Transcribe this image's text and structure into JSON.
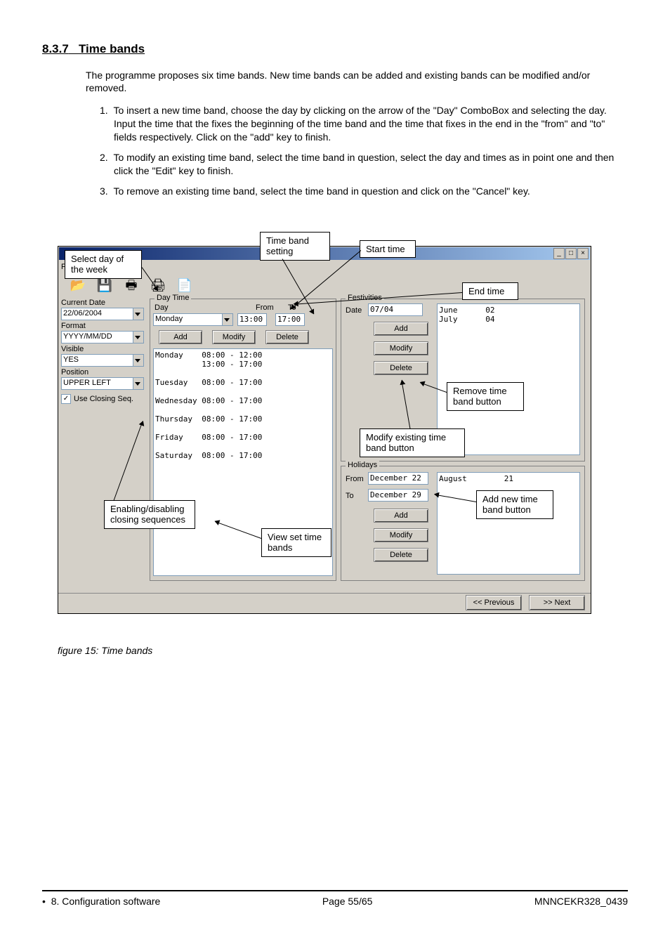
{
  "heading": {
    "number": "8.3.7",
    "title": "Time bands"
  },
  "intro": "The programme proposes six time bands. New time bands can be added and existing bands can be modified and/or removed.",
  "steps": [
    "To insert a new time band, choose the day by clicking on the arrow of the \"Day\" ComboBox and selecting the day. Input the time that the fixes the beginning of the time band and the time that fixes in the end in the  \"from\" and \"to\" fields respectively. Click on the \"add\" key to finish.",
    "To modify an existing time band, select the time band in question, select the day and times as in point one and then click the \"Edit\" key to finish.",
    "To remove an existing time band, select the time band in question and click on the \"Cancel\" key."
  ],
  "figure_caption": "figure 15: Time bands",
  "callouts": {
    "select_day": "Select  day of the week",
    "time_band_setting": "Time band setting",
    "start_time": "Start time",
    "end_time": "End time",
    "remove_btn": "Remove time band button",
    "modify_btn": "Modify existing time band button",
    "add_new_btn": "Add new time band button",
    "enabling": "Enabling/disabling closing sequences",
    "view_set": "View set time bands"
  },
  "menubar": {
    "help": "?"
  },
  "left_panel": {
    "current_date_label": "Current Date",
    "current_date_value": "22/06/2004",
    "format_label": "Format",
    "format_value": "YYYY/MM/DD",
    "visible_label": "Visible",
    "visible_value": "YES",
    "position_label": "Position",
    "position_value": "UPPER LEFT",
    "closing_seq_label": "Use Closing Seq."
  },
  "daytime": {
    "legend": "Day Time",
    "day_label": "Day",
    "from_label": "From",
    "to_label": "To",
    "day_value": "Monday",
    "from_value": "13:00",
    "to_value": "17:00",
    "add": "Add",
    "modify": "Modify",
    "delete": "Delete",
    "rows": [
      "Monday    08:00 - 12:00",
      "          13:00 - 17:00",
      "",
      "Tuesday   08:00 - 17:00",
      "",
      "Wednesday 08:00 - 17:00",
      "",
      "Thursday  08:00 - 17:00",
      "",
      "Friday    08:00 - 17:00",
      "",
      "Saturday  08:00 - 17:00"
    ]
  },
  "festivities": {
    "legend": "Festivities",
    "date_label": "Date",
    "date_value": "07/04",
    "add": "Add",
    "modify": "Modify",
    "delete": "Delete",
    "list": "June      02\nJuly      04"
  },
  "holidays": {
    "legend": "Holidays",
    "from_label": "From",
    "to_label": "To",
    "from_value": "December  22",
    "to_value": "December  29",
    "add": "Add",
    "modify": "Modify",
    "delete": "Delete",
    "list": "August        21"
  },
  "nav": {
    "prev": "<< Previous",
    "next": ">> Next"
  },
  "footer": {
    "left": "8. Configuration software",
    "center": "Page 55/65",
    "right": "MNNCEKR328_0439"
  }
}
